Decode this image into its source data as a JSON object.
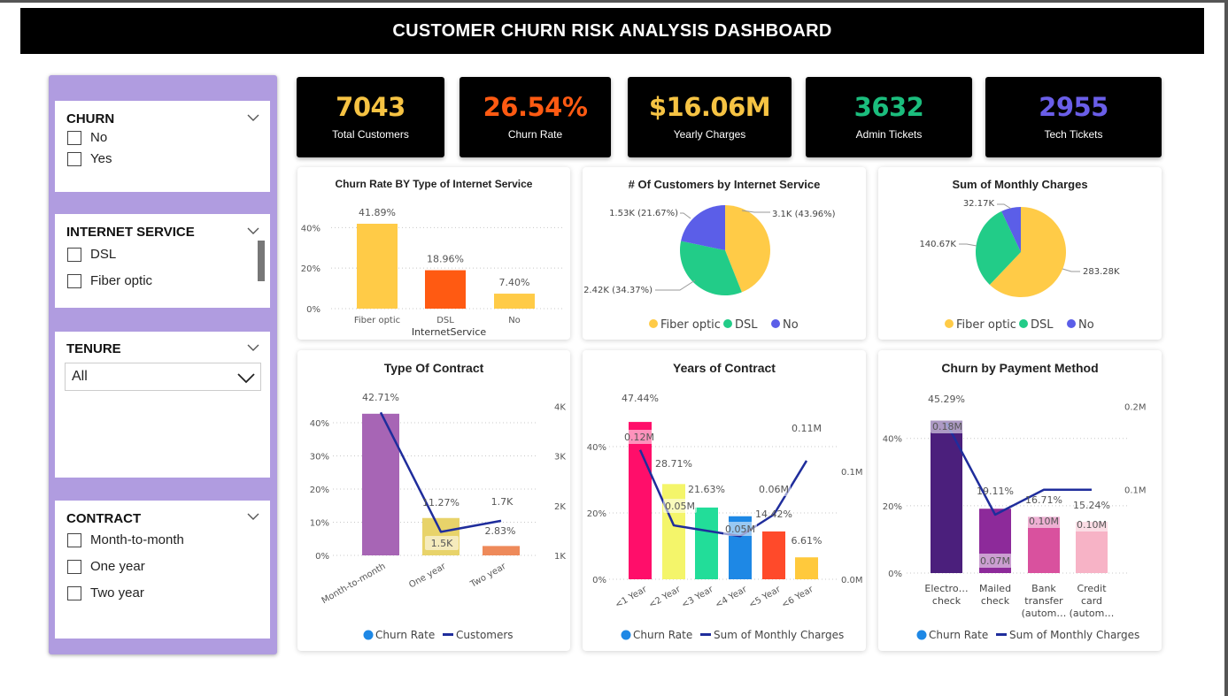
{
  "title": "CUSTOMER CHURN RISK ANALYSIS DASHBOARD",
  "filters": {
    "churn": {
      "title": "CHURN",
      "options": [
        "No",
        "Yes"
      ]
    },
    "internet": {
      "title": "INTERNET SERVICE",
      "options": [
        "DSL",
        "Fiber optic"
      ]
    },
    "tenure": {
      "title": "TENURE",
      "selected": "All"
    },
    "contract": {
      "title": "CONTRACT",
      "options": [
        "Month-to-month",
        "One year",
        "Two year"
      ]
    }
  },
  "kpis": [
    {
      "value": "7043",
      "label": "Total Customers",
      "color": "#f6c343"
    },
    {
      "value": "26.54%",
      "label": "Churn Rate",
      "color": "#ff5a12"
    },
    {
      "value": "$16.06M",
      "label": "Yearly Charges",
      "color": "#f6c343"
    },
    {
      "value": "3632",
      "label": "Admin Tickets",
      "color": "#1bbd7d"
    },
    {
      "value": "2955",
      "label": "Tech Tickets",
      "color": "#6a5ee8"
    }
  ],
  "chart_data": [
    {
      "type": "bar",
      "title": "Churn Rate BY Type of Internet Service",
      "xlabel": "InternetService",
      "ylabel": "",
      "categories": [
        "Fiber optic",
        "DSL",
        "No"
      ],
      "values": [
        41.89,
        18.96,
        7.4
      ],
      "data_labels": [
        "41.89%",
        "18.96%",
        "7.40%"
      ],
      "colors": [
        "#ffcb47",
        "#ff5a12",
        "#ffcb47"
      ],
      "y_ticks": [
        "0%",
        "20%",
        "40%"
      ],
      "ylim": [
        0,
        48
      ],
      "grid": true
    },
    {
      "type": "pie",
      "title": "# Of Customers by Internet Service",
      "categories": [
        "Fiber optic",
        "DSL",
        "No"
      ],
      "values": [
        3100,
        2420,
        1530
      ],
      "percent": [
        43.96,
        34.37,
        21.67
      ],
      "data_labels": [
        "3.1K (43.96%)",
        "2.42K (34.37%)",
        "1.53K (21.67%)"
      ],
      "colors": [
        "#ffcb47",
        "#22cc88",
        "#5b5ee8"
      ],
      "legend": "bottom"
    },
    {
      "type": "pie",
      "title": "Sum of Monthly Charges",
      "categories": [
        "Fiber optic",
        "DSL",
        "No"
      ],
      "values": [
        283.28,
        140.67,
        32.17
      ],
      "data_labels": [
        "283.28K",
        "140.67K",
        "32.17K"
      ],
      "colors": [
        "#ffcb47",
        "#22cc88",
        "#5b5ee8"
      ],
      "legend": "bottom"
    },
    {
      "type": "bar",
      "title": "Type Of Contract",
      "categories": [
        "Month-to-month",
        "One year",
        "Two year"
      ],
      "series": [
        {
          "name": "Churn Rate",
          "values": [
            42.71,
            11.27,
            2.83
          ],
          "colors": [
            "#a765b5",
            "#e8d36a",
            "#ee8a5a"
          ]
        },
        {
          "name": "Customers",
          "values": [
            3875,
            1473,
            1695
          ],
          "color": "#1f2d9c"
        }
      ],
      "bar_labels": [
        "42.71%",
        "11.27%",
        "2.83%"
      ],
      "line_labels": [
        "",
        "1.5K",
        "1.7K"
      ],
      "y_ticks": [
        "0%",
        "10%",
        "20%",
        "30%",
        "40%"
      ],
      "y2_ticks": [
        "1K",
        "2K",
        "3K",
        "4K"
      ],
      "ylim": [
        0,
        48
      ],
      "y2lim": [
        1000,
        4200
      ],
      "legend": "bottom",
      "legend_colors": [
        "#1e88e5",
        "#1f2d9c"
      ]
    },
    {
      "type": "bar",
      "title": "Years of Contract",
      "categories": [
        "<1 Year",
        "<2 Year",
        "<3 Year",
        "<4 Year",
        "<5 Year",
        "<6 Year"
      ],
      "series": [
        {
          "name": "Churn Rate",
          "values": [
            47.44,
            28.71,
            21.63,
            19.0,
            14.42,
            6.61
          ],
          "colors": [
            "#ff0e6a",
            "#f4f56a",
            "#22dd99",
            "#1e88e5",
            "#ff4a2a",
            "#ffc93c"
          ]
        },
        {
          "name": "Sum of Monthly Charges",
          "values": [
            0.12,
            0.05,
            0.045,
            0.04,
            0.06,
            0.11
          ],
          "color": "#1f2d9c"
        }
      ],
      "bar_labels": [
        "47.44%",
        "28.71%",
        "21.63%",
        "",
        "14.42%",
        "6.61%"
      ],
      "line_labels": [
        "0.12M",
        "0.05M",
        "",
        "0.05M",
        "0.06M",
        "0.11M"
      ],
      "y_ticks": [
        "0%",
        "20%",
        "40%"
      ],
      "y2_ticks": [
        "0.0M",
        "0.1M"
      ],
      "ylim": [
        0,
        52
      ],
      "y2lim": [
        0,
        0.16
      ],
      "legend": "bottom",
      "legend_colors": [
        "#1e88e5",
        "#1f2d9c"
      ]
    },
    {
      "type": "bar",
      "title": "Churn by Payment Method",
      "categories": [
        "Electronic check",
        "Mailed check",
        "Bank transfer (automatic)",
        "Credit card (automatic)"
      ],
      "tick_lines": [
        [
          "Electro…",
          "check"
        ],
        [
          "Mailed",
          "check"
        ],
        [
          "Bank",
          "transfer",
          "(autom…"
        ],
        [
          "Credit",
          "card",
          "(autom…"
        ]
      ],
      "series": [
        {
          "name": "Churn Rate",
          "values": [
            45.29,
            19.11,
            16.71,
            15.24
          ],
          "colors": [
            "#4b1f7c",
            "#8d2a9a",
            "#d9519e",
            "#f7b3c6"
          ]
        },
        {
          "name": "Sum of Monthly Charges",
          "values": [
            0.18,
            0.07,
            0.1,
            0.1
          ],
          "color": "#1f2d9c"
        }
      ],
      "bar_labels": [
        "45.29%",
        "19.11%",
        "16.71%",
        "15.24%"
      ],
      "line_labels": [
        "0.18M",
        "0.07M",
        "0.10M",
        "0.10M"
      ],
      "y_ticks": [
        "0%",
        "20%",
        "40%"
      ],
      "y2_ticks": [
        "0.1M",
        "0.2M"
      ],
      "ylim": [
        0,
        52
      ],
      "y2lim": [
        0,
        0.21
      ],
      "legend": "bottom",
      "legend_colors": [
        "#1e88e5",
        "#1f2d9c"
      ]
    }
  ]
}
